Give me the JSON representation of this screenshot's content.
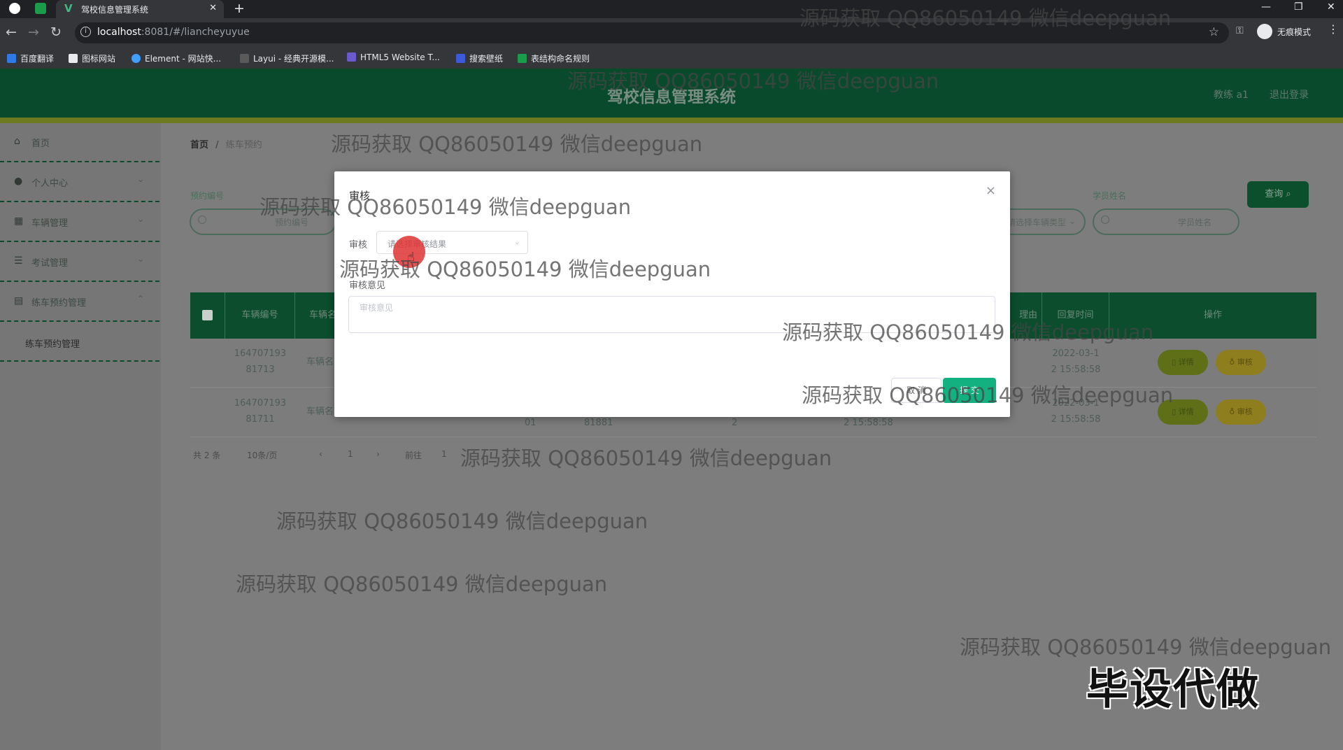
{
  "browser": {
    "tab_title": "驾校信息管理系统",
    "url_host": "localhost",
    "url_path": ":8081/#/liancheyuyue",
    "incognito_label": "无痕模式",
    "bookmarks": [
      "百度翻译",
      "图标网站",
      "Element - 网站快...",
      "Layui - 经典开源模...",
      "HTML5 Website T...",
      "搜索壁纸",
      "表结构命名规则"
    ]
  },
  "header": {
    "title": "驾校信息管理系统",
    "user": "教练 a1",
    "logout": "退出登录"
  },
  "sidebar": {
    "items": [
      {
        "label": "首页",
        "icon": "home-icon"
      },
      {
        "label": "个人中心",
        "icon": "user-icon"
      },
      {
        "label": "车辆管理",
        "icon": "car-icon"
      },
      {
        "label": "考试管理",
        "icon": "list-icon"
      },
      {
        "label": "练车预约管理",
        "icon": "calendar-icon"
      }
    ],
    "submenu": "练车预约管理"
  },
  "breadcrumb": {
    "home": "首页",
    "current": "练车预约"
  },
  "search": {
    "label_1": "预约编号",
    "placeholder_1": "预约编号",
    "placeholder_2": "请选择车辆类型",
    "label_3": "学员姓名",
    "placeholder_3": "学员姓名",
    "query_button": "查询"
  },
  "table": {
    "headers": [
      "车辆编号",
      "车辆名",
      "理由",
      "回复时间",
      "操作"
    ],
    "rows": [
      {
        "vehicle_no_1": "164707193",
        "vehicle_no_2": "81713",
        "vehicle_name": "车辆名",
        "reply_time_1": "2022-03-1",
        "reply_time_2": "2 15:58:58"
      },
      {
        "vehicle_no_1": "164707193",
        "vehicle_no_2": "81711",
        "vehicle_name": "车辆名",
        "reply_time_1": "2022-03-1",
        "reply_time_2": "2 15:58:58",
        "col_a": "01",
        "col_b": "81881",
        "col_c": "2",
        "col_d": "2 15:58:58"
      }
    ],
    "detail_button": "详情",
    "audit_button": "审核"
  },
  "pager": {
    "total": "共 2 条",
    "size": "10条/页",
    "page": "1",
    "goto": "前往",
    "goto_page": "1"
  },
  "modal": {
    "title": "审核",
    "audit_label": "审核",
    "select_placeholder": "请选择审核结果",
    "opinion_label": "审核意见",
    "opinion_placeholder": "审核意见",
    "cancel": "取 消",
    "submit": "提 交"
  },
  "watermark": "源码获取 QQ86050149 微信deepguan",
  "promo": "毕设代做"
}
